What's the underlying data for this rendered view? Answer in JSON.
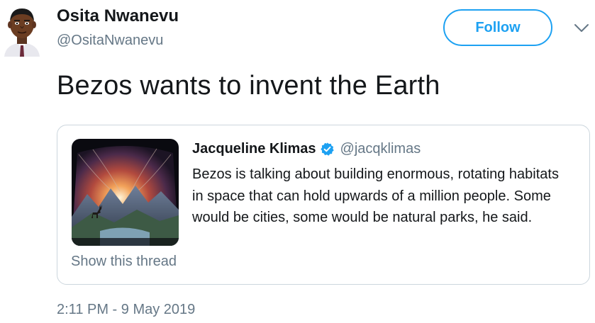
{
  "author": {
    "name": "Osita Nwanevu",
    "handle": "@OsitaNwanevu",
    "avatar": "avatar-illustration"
  },
  "follow_button": {
    "label": "Follow"
  },
  "menu": {
    "icon": "chevron-down-icon"
  },
  "tweet": {
    "text": "Bezos wants to invent the Earth"
  },
  "quoted_tweet": {
    "name": "Jacqueline Klimas",
    "verified": true,
    "handle": "@jacqklimas",
    "text": "Bezos is talking about building enormous, rotating habitats in space that can hold upwards of a million people. Some would be cities, some would be natural parks, he said.",
    "media": "space-habitat-image",
    "show_thread_label": "Show this thread"
  },
  "timestamp": "2:11 PM - 9 May 2019",
  "colors": {
    "accent": "#1da1f2",
    "text": "#14171a",
    "secondary": "#657786",
    "border": "#ccd6dd"
  }
}
